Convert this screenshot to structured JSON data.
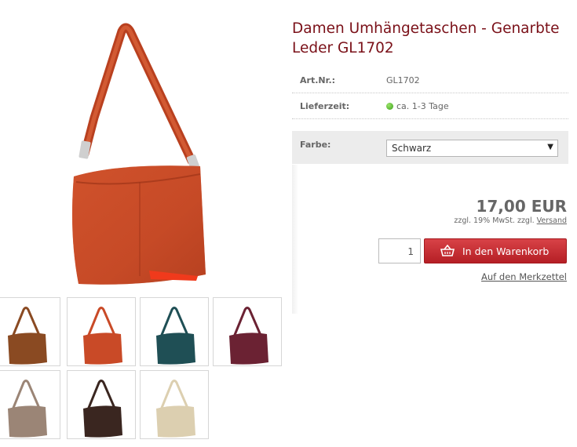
{
  "product": {
    "title": "Damen Umhängetaschen - Genarbte Leder GL1702",
    "main_color": "#c94a27",
    "attributes": [
      {
        "label": "Art.Nr.:",
        "value": "GL1702"
      },
      {
        "label": "Lieferzeit:",
        "value": "ca. 1-3 Tage",
        "status_color": "#3aa11a"
      }
    ],
    "color_option": {
      "label": "Farbe:",
      "selected": "Schwarz"
    },
    "price": "17,00 EUR",
    "tax_text": "zzgl. 19% MwSt. zzgl.",
    "shipping_link": "Versand",
    "quantity": "1",
    "add_to_cart": "In den Warenkorb",
    "wishlist": "Auf den Merkzettel"
  },
  "thumbnails": [
    {
      "color": "#8a4a22"
    },
    {
      "color": "#c94a27"
    },
    {
      "color": "#1f4f55"
    },
    {
      "color": "#6b2233"
    },
    {
      "color": "#9b8576"
    },
    {
      "color": "#3a2620"
    },
    {
      "color": "#dccfb0"
    }
  ]
}
